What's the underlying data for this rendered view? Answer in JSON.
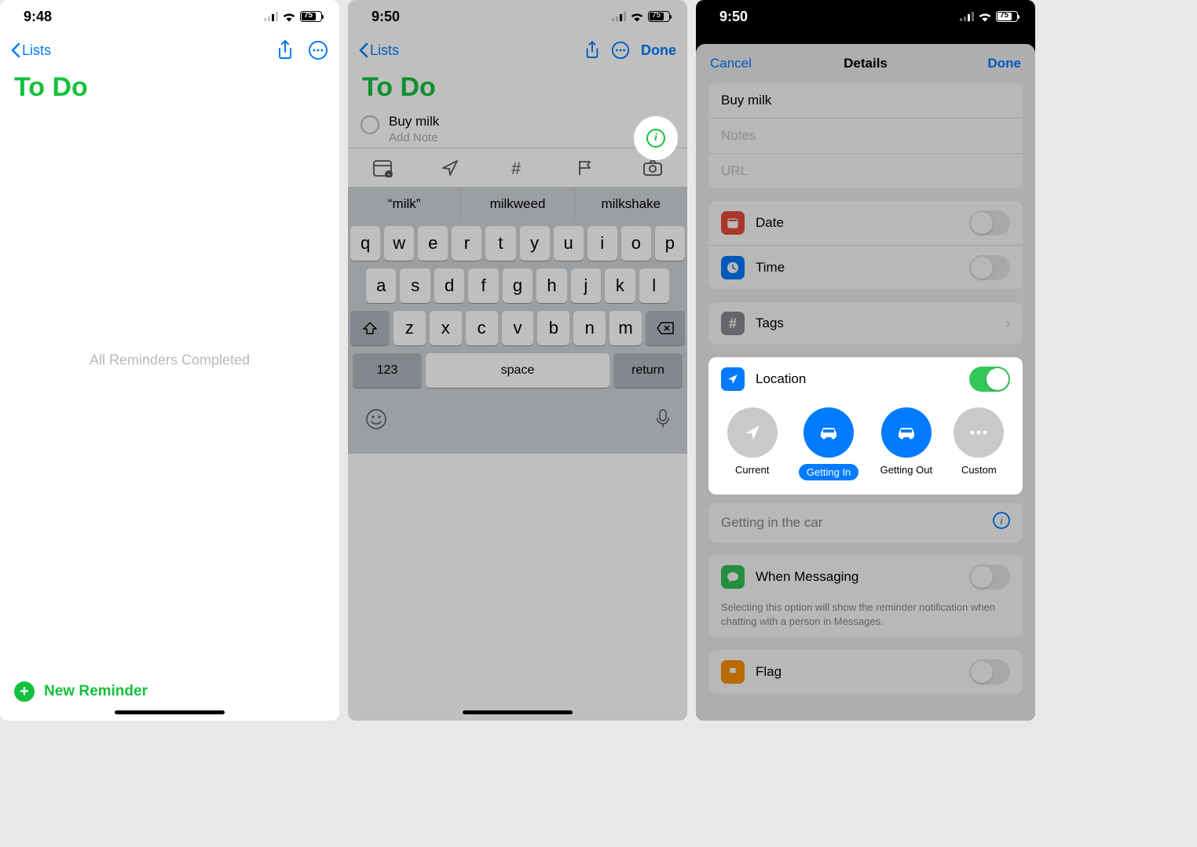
{
  "phone1": {
    "time": "9:48",
    "battery": "75",
    "back_label": "Lists",
    "title": "To Do",
    "empty_msg": "All Reminders Completed",
    "new_reminder": "New Reminder"
  },
  "phone2": {
    "time": "9:50",
    "battery": "75",
    "back_label": "Lists",
    "done": "Done",
    "title": "To Do",
    "reminder_title": "Buy milk",
    "add_note": "Add Note",
    "suggestions": [
      "“milk”",
      "milkweed",
      "milkshake"
    ],
    "row1": [
      "q",
      "w",
      "e",
      "r",
      "t",
      "y",
      "u",
      "i",
      "o",
      "p"
    ],
    "row2": [
      "a",
      "s",
      "d",
      "f",
      "g",
      "h",
      "j",
      "k",
      "l"
    ],
    "row3": [
      "z",
      "x",
      "c",
      "v",
      "b",
      "n",
      "m"
    ],
    "num": "123",
    "space": "space",
    "ret": "return"
  },
  "phone3": {
    "time": "9:50",
    "battery": "75",
    "cancel": "Cancel",
    "title": "Details",
    "done": "Done",
    "reminder_title": "Buy milk",
    "notes_placeholder": "Notes",
    "url_placeholder": "URL",
    "date_label": "Date",
    "time_label": "Time",
    "tags_label": "Tags",
    "location_label": "Location",
    "loc_current": "Current",
    "loc_getting_in": "Getting In",
    "loc_getting_out": "Getting Out",
    "loc_custom": "Custom",
    "getting_in_car": "Getting in the car",
    "messaging_label": "When Messaging",
    "messaging_desc": "Selecting this option will show the reminder notification when chatting with a person in Messages.",
    "flag_label": "Flag"
  }
}
